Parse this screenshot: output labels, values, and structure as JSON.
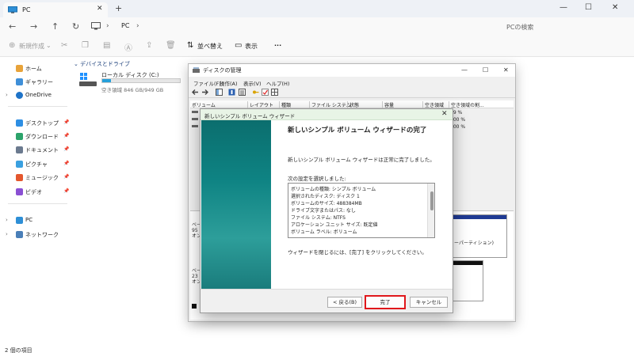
{
  "explorer": {
    "tab_label": "PC",
    "new_tab": "+",
    "close_tab": "✕",
    "address_text": "PC",
    "search_placeholder": "PCの検索",
    "toolbar": {
      "new_label": "新規作成",
      "new_chevron": "⌄",
      "sort_label": "並べ替え",
      "view_label": "表示",
      "more_label": "···"
    },
    "sidebar": {
      "home": "ホーム",
      "gallery": "ギャラリー",
      "onedrive": "OneDrive",
      "desktop": "デスクトップ",
      "downloads": "ダウンロード",
      "documents": "ドキュメント",
      "pictures": "ピクチャ",
      "music": "ミュージック",
      "videos": "ビデオ",
      "pc": "PC",
      "network": "ネットワーク"
    },
    "group_header": "デバイスとドライブ",
    "drive": {
      "name": "ローカル ディスク (C:)",
      "free_text": "空き領域 846 GB/949 GB",
      "used_fraction": 0.11
    },
    "status_text": "2 個の項目"
  },
  "disk_management": {
    "title": "ディスクの管理",
    "menu": [
      "ファイル(F)",
      "操作(A)",
      "表示(V)",
      "ヘルプ(H)"
    ],
    "columns": [
      "ボリューム",
      "レイアウト",
      "種類",
      "ファイル システム",
      "状態",
      "容量",
      "空き領域",
      "空き領域の割..."
    ],
    "free_pct": [
      "89 %",
      "100 %",
      "100 %"
    ],
    "disk0_lines": [
      "ベー",
      "95",
      "オン"
    ],
    "disk1_lines": [
      "ベー",
      "23",
      "オン"
    ],
    "partition_label": "ーパーティション)"
  },
  "wizard": {
    "title": "新しいシンプル ボリューム ウィザード",
    "heading": "新しいシンプル ボリューム ウィザードの完了",
    "completed_text": "新しいシンプル ボリューム ウィザードは正常に完了しました。",
    "settings_label": "次の設定を選択しました:",
    "settings": [
      "ボリュームの種類: シンプル ボリューム",
      "選択されたディスク: ディスク 1",
      "ボリュームのサイズ: 488384MB",
      "ドライブ文字またはパス: なし",
      "ファイル システム: NTFS",
      "アロケーション ユニット サイズ: 既定値",
      "ボリューム ラベル: ボリューム"
    ],
    "close_note": "ウィザードを閉じるには、[完了] をクリックしてください。",
    "back_button": "< 戻る(B)",
    "finish_button": "完了",
    "cancel_button": "キャンセル",
    "highlight_color": "#e0171b"
  }
}
